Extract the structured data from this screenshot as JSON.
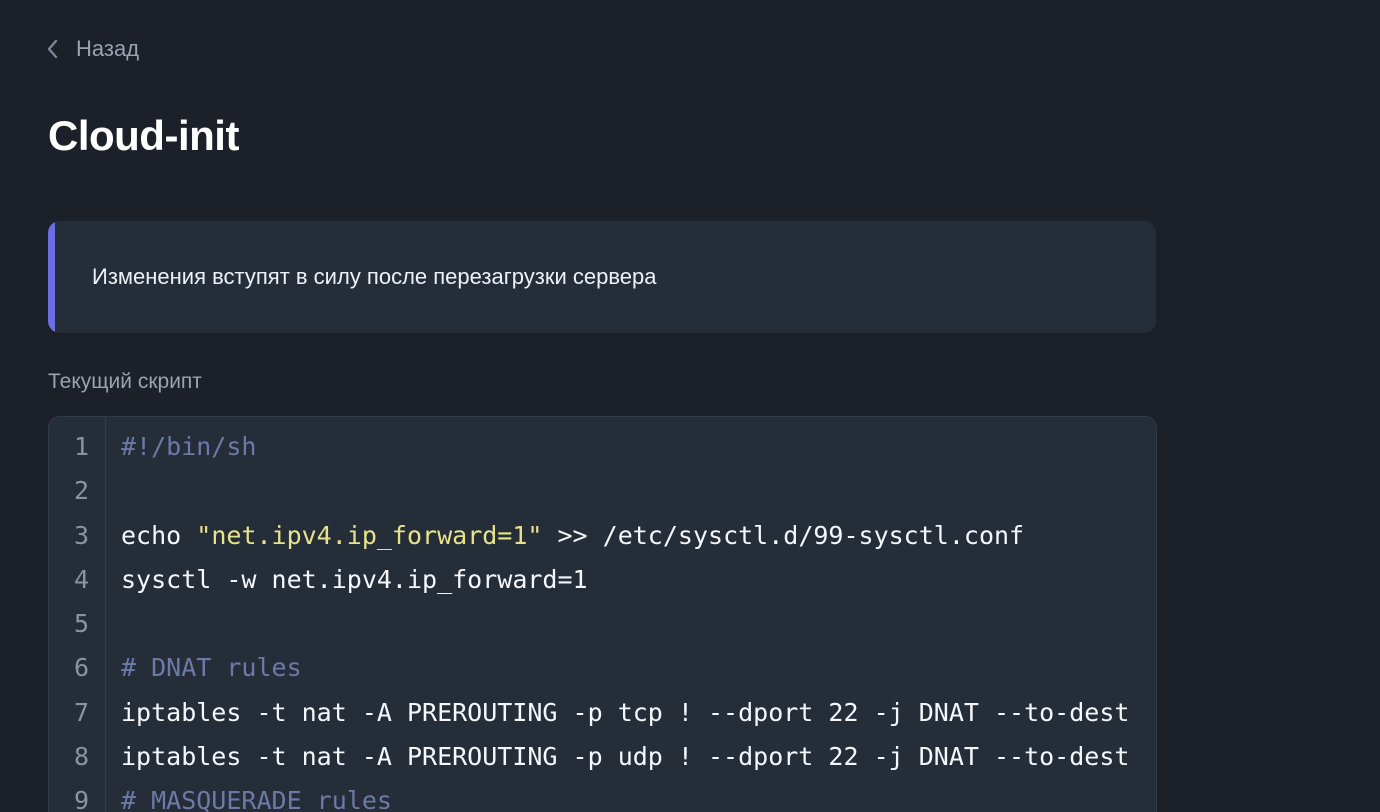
{
  "nav": {
    "back_label": "Назад"
  },
  "page": {
    "title": "Cloud-init"
  },
  "notice": {
    "text": "Изменения вступят в силу после перезагрузки сервера",
    "accent_color": "#6c6ee6"
  },
  "script_section": {
    "label": "Текущий скрипт"
  },
  "code": {
    "lines": [
      {
        "num": "1",
        "segments": [
          {
            "type": "comment",
            "text": "#!/bin/sh"
          }
        ]
      },
      {
        "num": "2",
        "segments": []
      },
      {
        "num": "3",
        "segments": [
          {
            "type": "plain",
            "text": "echo "
          },
          {
            "type": "string",
            "text": "\"net.ipv4.ip_forward=1\""
          },
          {
            "type": "plain",
            "text": " >> /etc/sysctl.d/99-sysctl.conf"
          }
        ]
      },
      {
        "num": "4",
        "segments": [
          {
            "type": "plain",
            "text": "sysctl -w net.ipv4.ip_forward=1"
          }
        ]
      },
      {
        "num": "5",
        "segments": []
      },
      {
        "num": "6",
        "segments": [
          {
            "type": "comment",
            "text": "# DNAT rules"
          }
        ]
      },
      {
        "num": "7",
        "segments": [
          {
            "type": "plain",
            "text": "iptables -t nat -A PREROUTING -p tcp ! --dport 22 -j DNAT --to-dest"
          }
        ]
      },
      {
        "num": "8",
        "segments": [
          {
            "type": "plain",
            "text": "iptables -t nat -A PREROUTING -p udp ! --dport 22 -j DNAT --to-dest"
          }
        ]
      },
      {
        "num": "9",
        "segments": [
          {
            "type": "comment",
            "text": "# MASQUERADE rules"
          }
        ]
      }
    ]
  },
  "colors": {
    "background": "#1b2029",
    "panel": "#252d39",
    "comment": "#6d7aa8",
    "string": "#e8e38a"
  },
  "icons": {
    "back": "chevron-left-icon"
  }
}
